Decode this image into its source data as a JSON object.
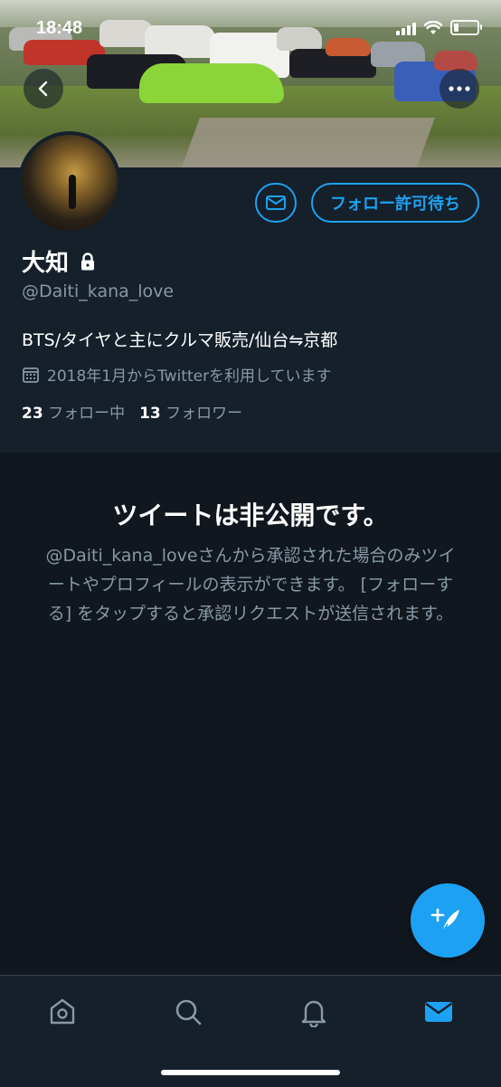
{
  "status_bar": {
    "time": "18:48"
  },
  "profile": {
    "name": "大知",
    "handle": "@Daiti_kana_love",
    "bio": "BTS/タイヤと主にクルマ販売/仙台⇋京都",
    "joined": "2018年1月からTwitterを利用しています",
    "following_count": "23",
    "following_label": "フォロー中",
    "followers_count": "13",
    "followers_label": "フォロワー"
  },
  "actions": {
    "follow_pending_label": "フォロー許可待ち"
  },
  "private_notice": {
    "title": "ツイートは非公開です。",
    "message": "@Daiti_kana_loveさんから承認された場合のみツイートやプロフィールの表示ができます。 [フォローする] をタップすると承認リクエストが送信されます。"
  },
  "icons": {
    "back": "chevron-left-icon",
    "more": "more-icon",
    "lock": "lock-icon",
    "calendar": "calendar-icon",
    "mail": "mail-icon",
    "compose": "compose-icon",
    "home": "home-icon",
    "search": "search-icon",
    "notifications": "bell-icon",
    "messages": "mail-icon"
  },
  "colors": {
    "background": "#15202b",
    "accent": "#1da1f2",
    "secondary_text": "#8899a6"
  }
}
